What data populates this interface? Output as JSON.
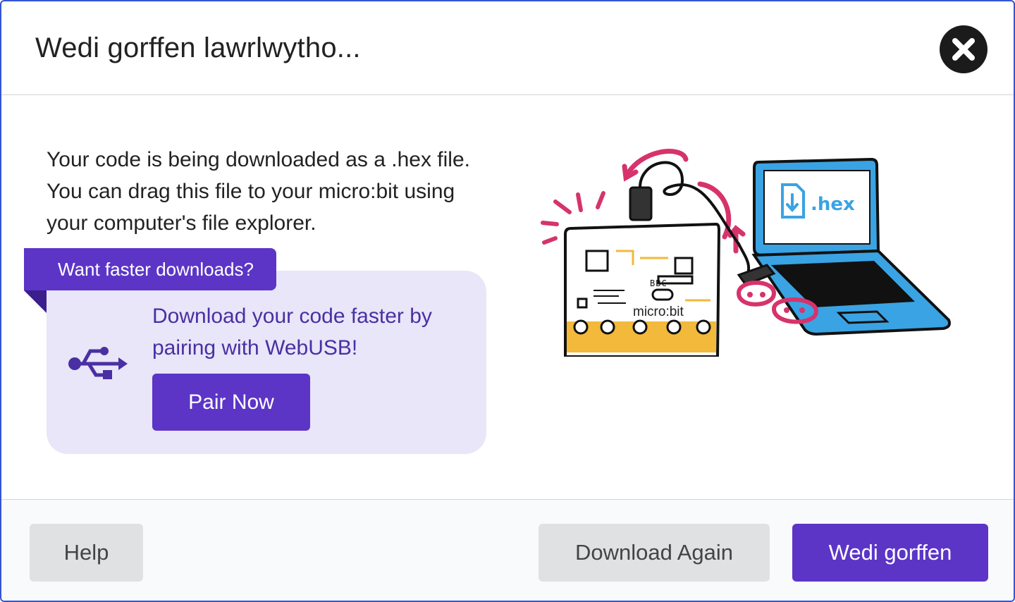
{
  "dialog": {
    "title": "Wedi gorffen lawrlwytho...",
    "close_icon": "close-icon"
  },
  "content": {
    "description": "Your code is being downloaded as a .hex file. You can drag this file to your micro:bit using your computer's file explorer.",
    "promo": {
      "banner": "Want faster downloads?",
      "text": "Download your code faster by pairing with WebUSB!",
      "pair_button": "Pair Now",
      "icon": "usb-icon"
    },
    "illustration": {
      "board_brand": "BBC",
      "board_label": "micro:bit",
      "file_label": ".hex"
    }
  },
  "footer": {
    "help_label": "Help",
    "download_again_label": "Download Again",
    "done_label": "Wedi gorffen"
  },
  "colors": {
    "accent": "#5c35c7",
    "promo_background": "#e8e6f8",
    "promo_text": "#4a2fa3",
    "modal_border": "#3454d1",
    "secondary_button": "#e0e1e2",
    "laptop_blue": "#3aa3e3",
    "board_yellow": "#f2b93b",
    "doodle_pink": "#d6336c"
  }
}
